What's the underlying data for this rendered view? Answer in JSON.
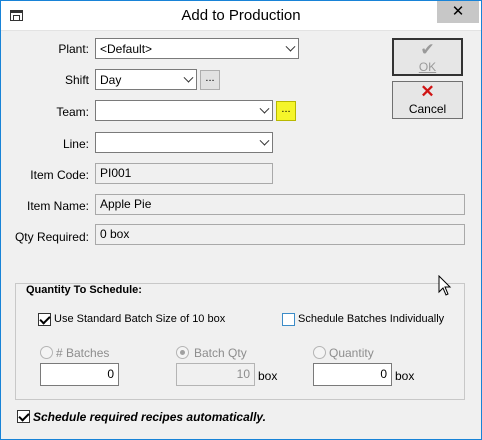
{
  "window": {
    "title": "Add to Production",
    "close_glyph": "✕"
  },
  "buttons": {
    "ok": {
      "label": "OK",
      "glyph": "✔",
      "enabled": false
    },
    "cancel": {
      "label": "Cancel",
      "glyph": "✕",
      "glyph_color": "#d01414"
    }
  },
  "form": {
    "plant": {
      "label": "Plant:",
      "value": "<Default>"
    },
    "shift": {
      "label": "Shift",
      "value": "Day",
      "lookup": "..."
    },
    "team": {
      "label": "Team:",
      "value": "",
      "lookup": "..."
    },
    "line": {
      "label": "Line:",
      "value": ""
    },
    "item_code": {
      "label": "Item Code:",
      "value": "PI001"
    },
    "item_name": {
      "label": "Item Name:",
      "value": "Apple Pie"
    },
    "qty_required": {
      "label": "Qty Required:",
      "value": "0 box"
    }
  },
  "schedule": {
    "group_title": "Quantity To Schedule:",
    "use_standard_batch": {
      "label": "Use Standard Batch Size of 10 box",
      "checked": true
    },
    "schedule_individually": {
      "label": "Schedule Batches Individually",
      "checked": false
    },
    "batches": {
      "label": "# Batches",
      "value": "0",
      "selected": false
    },
    "batch_qty": {
      "label": "Batch Qty",
      "value": "10",
      "unit": "box",
      "selected": true
    },
    "quantity": {
      "label": "Quantity",
      "value": "0",
      "unit": "box",
      "selected": false
    }
  },
  "auto_recipes": {
    "label": "Schedule required recipes automatically.",
    "checked": true
  },
  "colors": {
    "highlight": "#f5f52a",
    "cancel_x": "#d01414",
    "title_border": "#1883d7"
  }
}
